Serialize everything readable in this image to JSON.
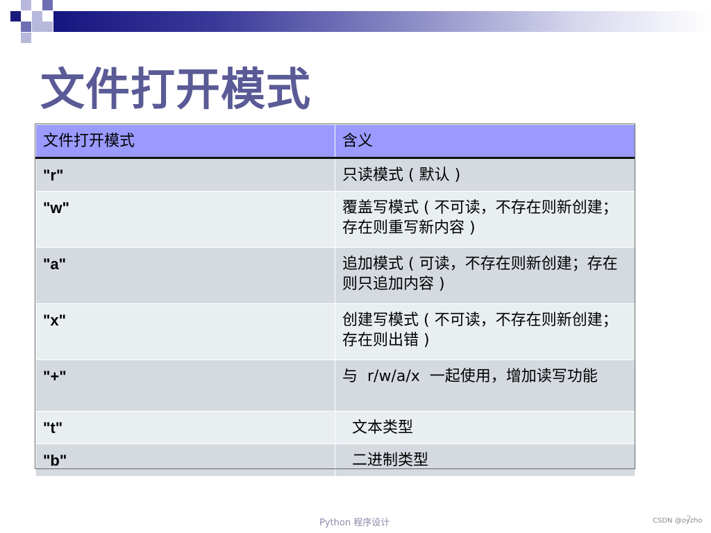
{
  "slide": {
    "title": "文件打开模式",
    "footer": "Python 程序设计",
    "page_number": "7",
    "watermark": "CSDN @oyzho"
  },
  "table": {
    "headers": [
      "文件打开模式",
      "含义"
    ],
    "rows": [
      {
        "mode": "\"r\"",
        "meaning": "只读模式 ( 默认 )"
      },
      {
        "mode": "\"w\"",
        "meaning": "覆盖写模式 ( 不可读，不存在则新创建；存在则重写新内容 )"
      },
      {
        "mode": "\"a\"",
        "meaning": "追加模式 ( 可读，不存在则新创建；存在则只追加内容 )"
      },
      {
        "mode": "\"x\"",
        "meaning": "创建写模式 ( 不可读，不存在则新创建；存在则出错 )"
      },
      {
        "mode": "\"+\"",
        "meaning": "与  r/w/a/x  一起使用，增加读写功能"
      },
      {
        "mode": "\"t\"",
        "meaning": "  文本类型"
      },
      {
        "mode": "\"b\"",
        "meaning": "  二进制类型"
      }
    ]
  },
  "colors": {
    "title": "#5a5a96",
    "header_bg": "#9a9aff",
    "row_odd": "#d4dae0",
    "row_even": "#e9eef1",
    "band_dark": "#161680"
  }
}
